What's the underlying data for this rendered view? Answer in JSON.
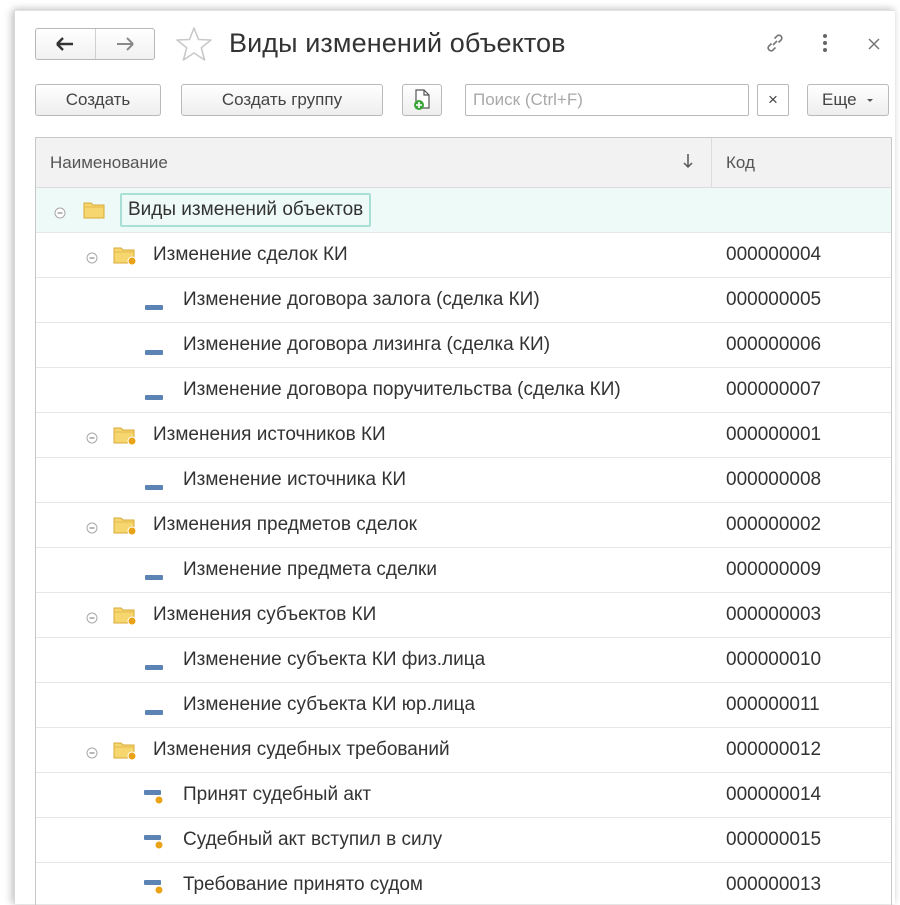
{
  "window": {
    "title": "Виды изменений объектов",
    "icons": [
      "back-arrow-icon",
      "forward-arrow-icon",
      "star-icon",
      "link-icon",
      "more-vertical-icon",
      "close-icon"
    ]
  },
  "toolbar": {
    "create_label": "Создать",
    "create_group_label": "Создать группу",
    "search_placeholder": "Поиск (Ctrl+F)",
    "search_clear_label": "×",
    "more_label": "Еще"
  },
  "table": {
    "columns": {
      "name": "Наименование",
      "code": "Код"
    },
    "rows": [
      {
        "type": "root",
        "name": "Виды изменений объектов",
        "code": ""
      },
      {
        "type": "group",
        "name": "Изменение сделок КИ",
        "code": "000000004"
      },
      {
        "type": "item",
        "name": "Изменение договора залога (сделка КИ)",
        "code": "000000005"
      },
      {
        "type": "item",
        "name": "Изменение договора лизинга (сделка КИ)",
        "code": "000000006"
      },
      {
        "type": "item",
        "name": "Изменение договора поручительства (сделка КИ)",
        "code": "000000007"
      },
      {
        "type": "group",
        "name": "Изменения источников КИ",
        "code": "000000001"
      },
      {
        "type": "item",
        "name": "Изменение источника КИ",
        "code": "000000008"
      },
      {
        "type": "group",
        "name": "Изменения предметов сделок",
        "code": "000000002"
      },
      {
        "type": "item",
        "name": "Изменение предмета сделки",
        "code": "000000009"
      },
      {
        "type": "group",
        "name": "Изменения субъектов КИ",
        "code": "000000003"
      },
      {
        "type": "item",
        "name": "Изменение субъекта КИ физ.лица",
        "code": "000000010"
      },
      {
        "type": "item",
        "name": "Изменение субъекта КИ юр.лица",
        "code": "000000011"
      },
      {
        "type": "group",
        "name": "Изменения судебных требований",
        "code": "000000012"
      },
      {
        "type": "predefined-item",
        "name": "Принят судебный акт",
        "code": "000000014"
      },
      {
        "type": "predefined-item",
        "name": "Судебный акт вступил в силу",
        "code": "000000015"
      },
      {
        "type": "predefined-item",
        "name": "Требование принято судом",
        "code": "000000013"
      }
    ]
  },
  "colors": {
    "selection_background": "#eefaf7",
    "selection_border": "#a9dfd4",
    "folder_yellow": "#f2c94c",
    "item_marker_blue": "#5b83b3",
    "predefined_dot": "#e8a317"
  }
}
